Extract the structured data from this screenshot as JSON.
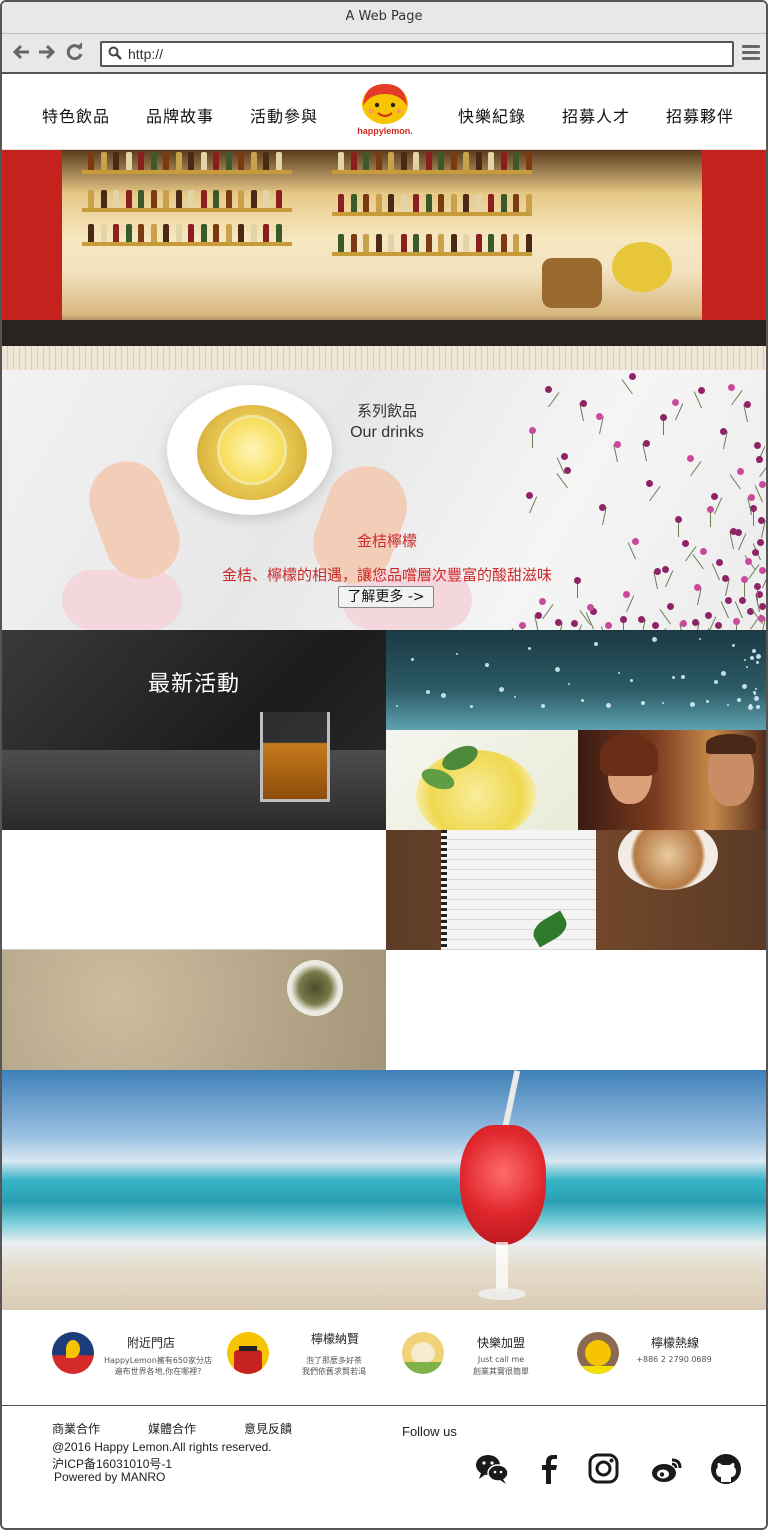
{
  "browser": {
    "window_title": "A Web Page",
    "url": "http://"
  },
  "nav": {
    "items": [
      "特色飲品",
      "品牌故事",
      "活動參與",
      "快樂紀錄",
      "招募人才",
      "招募夥伴"
    ],
    "logo_text": "happylemon."
  },
  "drinks": {
    "title_cn": "系列飲品",
    "title_en": "Our drinks",
    "product_name": "金桔檸檬",
    "product_desc": "金桔、檸檬的相遇，讓您品嚐層次豐富的酸甜滋味",
    "more_button": "了解更多 ->"
  },
  "latest": {
    "title": "最新活動"
  },
  "info": [
    {
      "title": "附近門店",
      "line1": "HappyLemon擁有650家分店",
      "line2": "遍布世界各地,你在哪裡?"
    },
    {
      "title": "檸檬納賢",
      "line1": "泡了那麼多好茶",
      "line2": "我們依舊求賢若渴"
    },
    {
      "title": "快樂加盟",
      "line1": "Just call me",
      "line2": "創業其實很簡單"
    },
    {
      "title": "檸檬熱線",
      "line1": "+886 2 2790 0689",
      "line2": ""
    }
  ],
  "footer": {
    "links": [
      "商業合作",
      "媒體合作",
      "意見反饋"
    ],
    "copyright": "@2016 Happy Lemon.All rights reserved.",
    "icp": "沪ICP备16031010号-1",
    "powered": "Powered by MANRO",
    "follow": "Follow us",
    "socials": [
      "wechat-icon",
      "facebook-icon",
      "instagram-icon",
      "weibo-icon",
      "github-icon"
    ]
  },
  "colors": {
    "accent_red": "#cc2a2a",
    "brand_yellow": "#f6c400"
  }
}
